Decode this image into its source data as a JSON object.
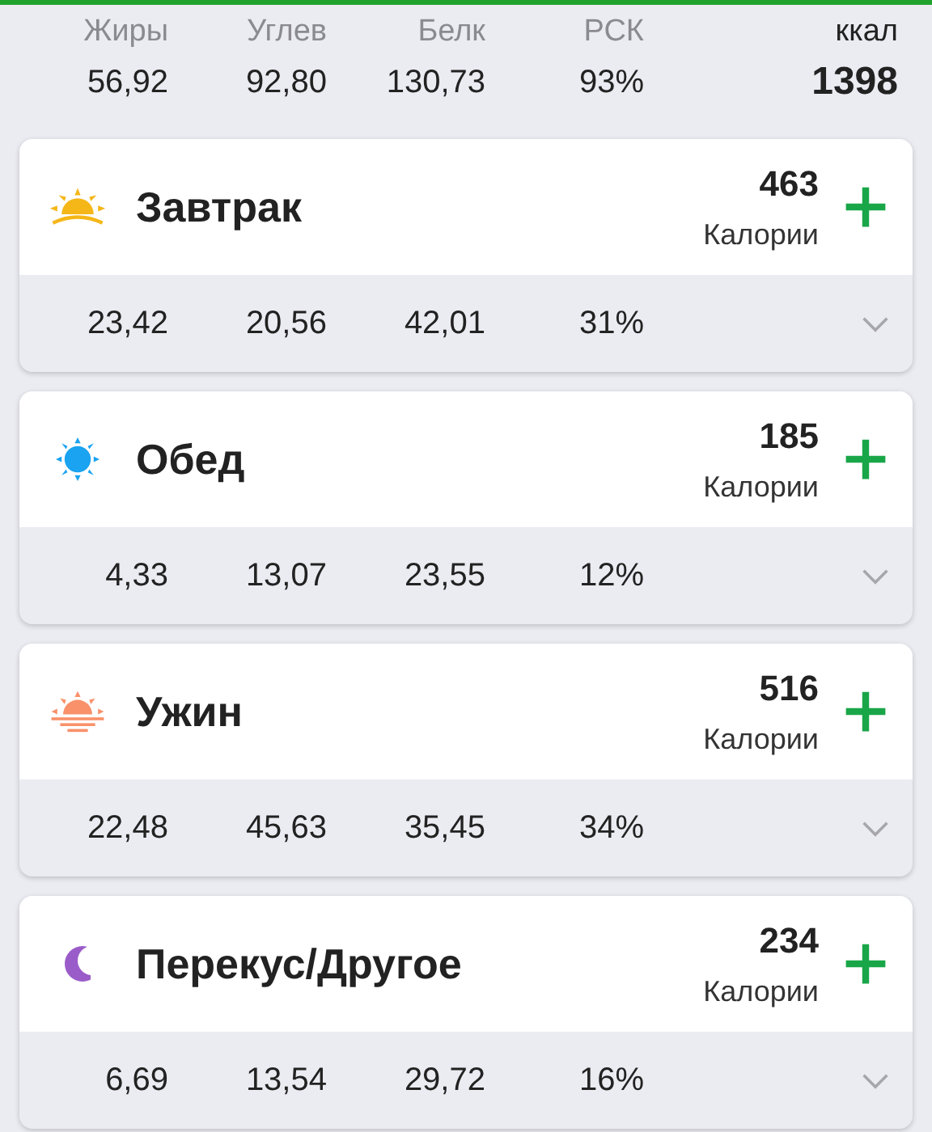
{
  "summary": {
    "columns": [
      {
        "label": "Жиры",
        "value": "56,92"
      },
      {
        "label": "Углев",
        "value": "92,80"
      },
      {
        "label": "Белк",
        "value": "130,73"
      },
      {
        "label": "РСК",
        "value": "93%"
      }
    ],
    "energy": {
      "label": "ккал",
      "value": "1398"
    }
  },
  "meals": [
    {
      "kind": "sunrise",
      "name": "Завтрак",
      "calories": "463",
      "calories_label": "Калории",
      "values": [
        "23,42",
        "20,56",
        "42,01",
        "31%"
      ]
    },
    {
      "kind": "sun",
      "name": "Обед",
      "calories": "185",
      "calories_label": "Калории",
      "values": [
        "4,33",
        "13,07",
        "23,55",
        "12%"
      ]
    },
    {
      "kind": "sunset",
      "name": "Ужин",
      "calories": "516",
      "calories_label": "Калории",
      "values": [
        "22,48",
        "45,63",
        "35,45",
        "34%"
      ]
    },
    {
      "kind": "moon",
      "name": "Перекус/Другое",
      "calories": "234",
      "calories_label": "Калории",
      "values": [
        "6,69",
        "13,54",
        "29,72",
        "16%"
      ]
    }
  ]
}
